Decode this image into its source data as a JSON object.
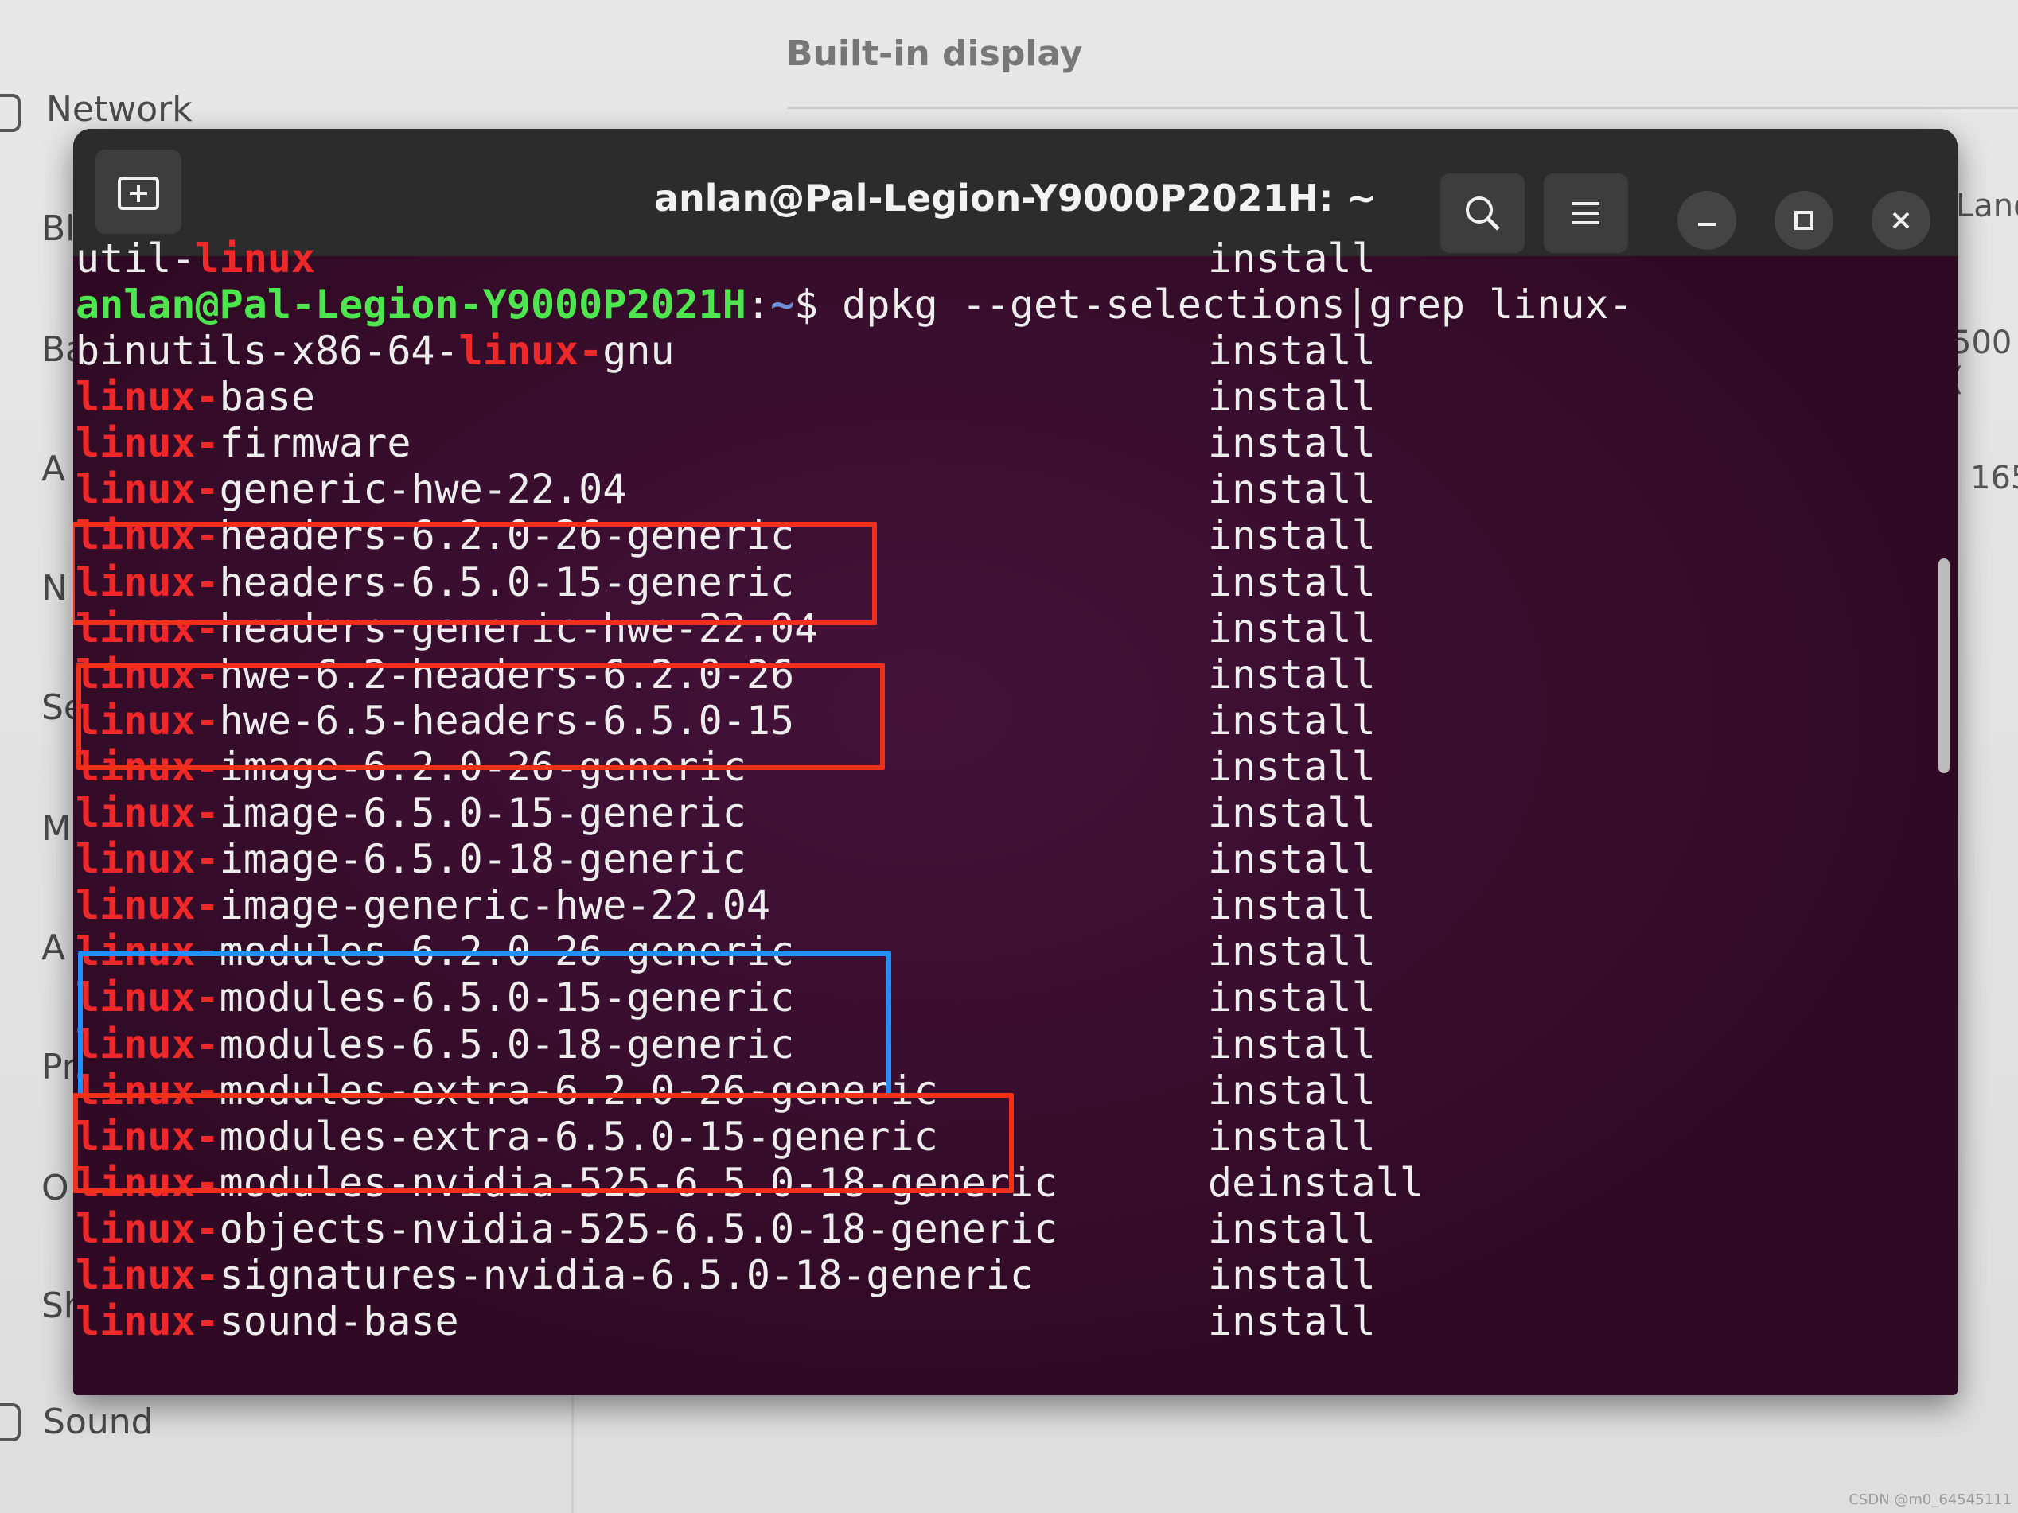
{
  "background_settings": {
    "builtin_display": "Built-in display",
    "sidebar": [
      {
        "label": "Network"
      },
      {
        "label": "Bl"
      },
      {
        "label": "Ba"
      },
      {
        "label": "A"
      },
      {
        "label": "N"
      },
      {
        "label": "Se"
      },
      {
        "label": "M"
      },
      {
        "label": "A"
      },
      {
        "label": "Pr"
      },
      {
        "label": "O"
      },
      {
        "label": "Sh"
      },
      {
        "label": "Sound"
      }
    ],
    "right_peek": [
      "Land",
      "500 (",
      "165"
    ]
  },
  "terminal": {
    "title": "anlan@Pal-Legion-Y9000P2021H: ~",
    "top_partial": {
      "name": "util-",
      "red": "linux",
      "status": "install"
    },
    "prompt": {
      "user": "anlan@Pal-Legion-Y9000P2021H",
      "sep": ":",
      "path": "~",
      "symbol": "$",
      "command": " dpkg --get-selections|grep linux-"
    },
    "rows": [
      {
        "pre": "binutils-x86-64-",
        "red": "linux-",
        "post": "gnu",
        "status": "install"
      },
      {
        "pre": "",
        "red": "linux-",
        "post": "base",
        "status": "install"
      },
      {
        "pre": "",
        "red": "linux-",
        "post": "firmware",
        "status": "install"
      },
      {
        "pre": "",
        "red": "linux-",
        "post": "generic-hwe-22.04",
        "status": "install"
      },
      {
        "pre": "",
        "red": "linux-",
        "post": "headers-6.2.0-26-generic",
        "status": "install"
      },
      {
        "pre": "",
        "red": "linux-",
        "post": "headers-6.5.0-15-generic",
        "status": "install"
      },
      {
        "pre": "",
        "red": "linux-",
        "post": "headers-generic-hwe-22.04",
        "status": "install"
      },
      {
        "pre": "",
        "red": "linux-",
        "post": "hwe-6.2-headers-6.2.0-26",
        "status": "install"
      },
      {
        "pre": "",
        "red": "linux-",
        "post": "hwe-6.5-headers-6.5.0-15",
        "status": "install"
      },
      {
        "pre": "",
        "red": "linux-",
        "post": "image-6.2.0-26-generic",
        "status": "install"
      },
      {
        "pre": "",
        "red": "linux-",
        "post": "image-6.5.0-15-generic",
        "status": "install"
      },
      {
        "pre": "",
        "red": "linux-",
        "post": "image-6.5.0-18-generic",
        "status": "install"
      },
      {
        "pre": "",
        "red": "linux-",
        "post": "image-generic-hwe-22.04",
        "status": "install"
      },
      {
        "pre": "",
        "red": "linux-",
        "post": "modules-6.2.0-26-generic",
        "status": "install"
      },
      {
        "pre": "",
        "red": "linux-",
        "post": "modules-6.5.0-15-generic",
        "status": "install"
      },
      {
        "pre": "",
        "red": "linux-",
        "post": "modules-6.5.0-18-generic",
        "status": "install"
      },
      {
        "pre": "",
        "red": "linux-",
        "post": "modules-extra-6.2.0-26-generic",
        "status": "install"
      },
      {
        "pre": "",
        "red": "linux-",
        "post": "modules-extra-6.5.0-15-generic",
        "status": "install"
      },
      {
        "pre": "",
        "red": "linux-",
        "post": "modules-nvidia-525-6.5.0-18-generic",
        "status": "deinstall"
      },
      {
        "pre": "",
        "red": "linux-",
        "post": "objects-nvidia-525-6.5.0-18-generic",
        "status": "install"
      },
      {
        "pre": "",
        "red": "linux-",
        "post": "signatures-nvidia-6.5.0-18-generic",
        "status": "install"
      },
      {
        "pre": "",
        "red": "linux-",
        "post": "sound-base",
        "status": "install"
      }
    ]
  },
  "watermark": "CSDN @m0_64545111",
  "colors": {
    "terminal_bg": "#300a24",
    "match_red": "#ef2929",
    "prompt_green": "#4ee64e",
    "highlight_red": "#f03018",
    "highlight_blue": "#1e90ff"
  }
}
